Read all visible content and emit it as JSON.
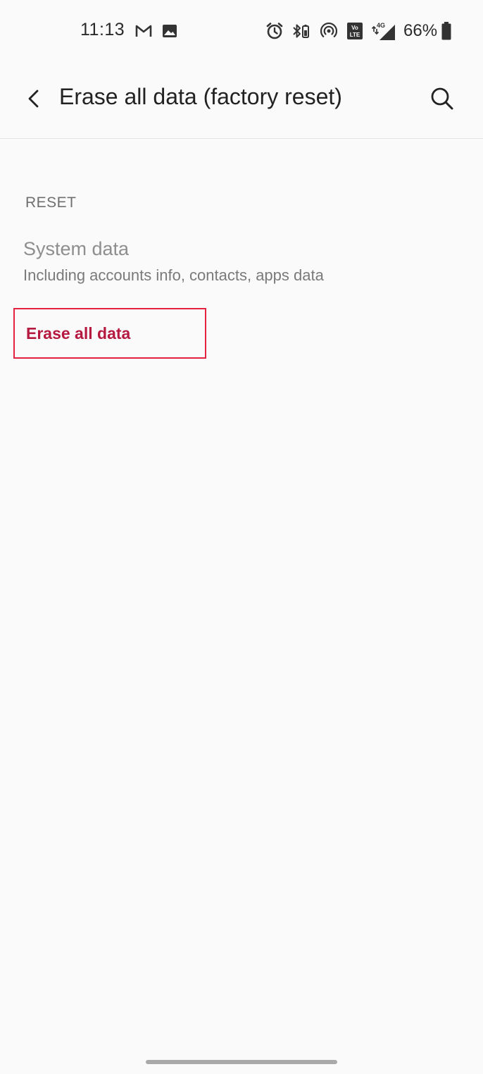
{
  "status_bar": {
    "time": "11:13",
    "battery_percent": "66%",
    "network_label": "4G",
    "volte_label": "Vo LTE",
    "left_icons": [
      "gmail-icon",
      "image-icon"
    ],
    "right_icons": [
      "alarm-icon",
      "bluetooth-icon",
      "hotspot-icon",
      "volte-icon",
      "signal-icon",
      "battery-icon"
    ]
  },
  "app_bar": {
    "title": "Erase all data (factory reset)",
    "back_icon": "back-arrow-icon",
    "search_icon": "search-icon"
  },
  "section": {
    "header": "RESET",
    "item": {
      "title": "System data",
      "summary": "Including accounts info, contacts, apps data"
    },
    "action": {
      "label": "Erase all data"
    }
  },
  "colors": {
    "background": "#fafafa",
    "accent": "#b5193f",
    "highlight_border": "#e5223d"
  }
}
